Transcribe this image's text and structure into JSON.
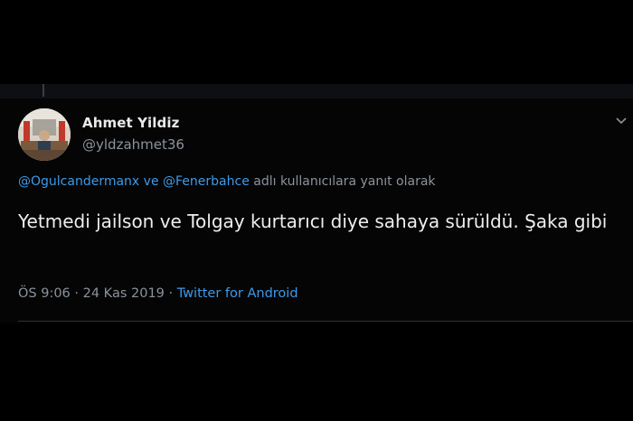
{
  "tweet": {
    "author_name": "Ahmet Yildiz",
    "author_handle": "@yldzahmet36",
    "reply_to": {
      "mention_1": "@Ogulcandermanx",
      "connector": " ve ",
      "mention_2": "@Fenerbahce",
      "suffix": " adlı kullanıcılara yanıt olarak"
    },
    "text": "Yetmedi jailson ve Tolgay kurtarıcı diye sahaya sürüldü. Şaka gibi",
    "time": "ÖS 9:06",
    "separator": " · ",
    "date": "24 Kas 2019",
    "source": "Twitter for Android"
  },
  "icons": {
    "avatar": "profile-photo-icon",
    "menu": "chevron-down-icon"
  },
  "colors": {
    "background": "#000000",
    "link": "#3d9ae8",
    "secondary_text": "#8a939c",
    "primary_text": "#eeeeee"
  }
}
